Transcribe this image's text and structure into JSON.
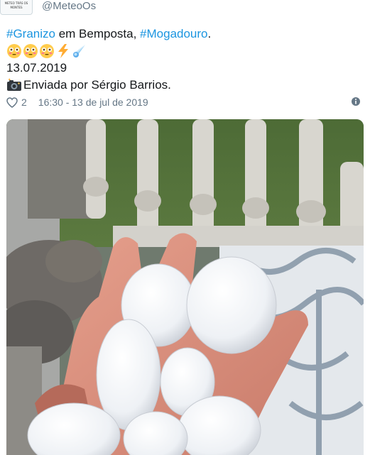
{
  "account": {
    "handle": "@MeteoOs",
    "avatar_icon": "meteo-logo-icon"
  },
  "tweet": {
    "hashtag1": "#Granizo",
    "middle_text": " em Bemposta, ",
    "hashtag2": "#Mogadouro",
    "end_text": ".",
    "emojis": [
      "flushed-face-icon",
      "flushed-face-icon",
      "flushed-face-icon",
      "lightning-icon",
      "comet-icon"
    ],
    "date_line": "13.07.2019",
    "sent_by": "Enviada por Sérgio Barrios."
  },
  "meta": {
    "likes": "2",
    "timestamp": "16:30 - 13 de jul de 2019",
    "like_icon": "heart-icon",
    "info_icon": "info-icon"
  },
  "colors": {
    "link": "#1b95e0",
    "text": "#14171a",
    "muted": "#657786"
  },
  "photo": {
    "subject": "hail-stones-photo"
  }
}
